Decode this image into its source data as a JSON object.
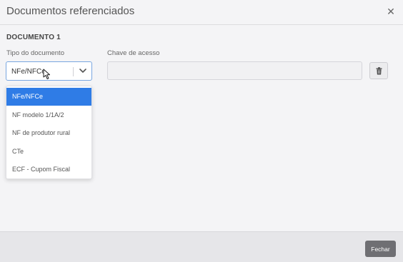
{
  "modal": {
    "title": "Documentos referenciados"
  },
  "document": {
    "label": "DOCUMENTO 1",
    "tipo": {
      "label": "Tipo do documento",
      "selected": "NFe/NFCe",
      "options": [
        "NFe/NFCe",
        "NF modelo 1/1A/2",
        "NF de produtor rural",
        "CTe",
        "ECF - Cupom Fiscal"
      ]
    },
    "chave": {
      "label": "Chave de acesso",
      "value": ""
    }
  },
  "footer": {
    "close_label": "Fechar"
  },
  "icons": {
    "close": "close-icon",
    "chevron": "chevron-down-icon",
    "trash": "trash-icon",
    "cursor": "mouse-cursor-icon"
  },
  "colors": {
    "accent": "#2f7ce6",
    "button_dark": "#6f6f73"
  }
}
